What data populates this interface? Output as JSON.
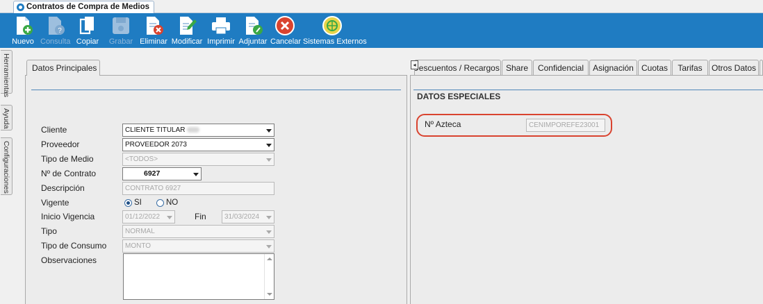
{
  "window": {
    "tab_title": "Contratos de Compra de Medios"
  },
  "toolbar": {
    "buttons": [
      {
        "label": "Nuevo",
        "icon": "new-doc-icon",
        "enabled": true
      },
      {
        "label": "Consulta",
        "icon": "query-doc-icon",
        "enabled": false
      },
      {
        "label": "Copiar",
        "icon": "copy-icon",
        "enabled": true
      },
      {
        "label": "Grabar",
        "icon": "save-disk-icon",
        "enabled": false
      },
      {
        "label": "Eliminar",
        "icon": "delete-doc-icon",
        "enabled": true
      },
      {
        "label": "Modificar",
        "icon": "edit-doc-icon",
        "enabled": true
      },
      {
        "label": "Imprimir",
        "icon": "printer-icon",
        "enabled": true
      },
      {
        "label": "Adjuntar",
        "icon": "attach-doc-icon",
        "enabled": true
      },
      {
        "label": "Cancelar",
        "icon": "cancel-icon",
        "enabled": true
      },
      {
        "label": "Sistemas Externos",
        "icon": "external-systems-icon",
        "enabled": true
      }
    ]
  },
  "side_tabs": [
    "Herramientas",
    "Ayuda",
    "Configuraciones"
  ],
  "left": {
    "tab": "Datos Principales",
    "form": {
      "cliente": {
        "label": "Cliente",
        "value": "CLIENTE TITULAR"
      },
      "proveedor": {
        "label": "Proveedor",
        "value": "PROVEEDOR 2073"
      },
      "tipo_medio": {
        "label": "Tipo de Medio",
        "value": "<TODOS>"
      },
      "contrato": {
        "label": "Nº de Contrato",
        "value": "6927"
      },
      "descripcion": {
        "label": "Descripción",
        "value": "CONTRATO 6927"
      },
      "vigente": {
        "label": "Vigente",
        "opt_si": "SI",
        "opt_no": "NO",
        "selected": "SI"
      },
      "inicio": {
        "label": "Inicio Vigencia",
        "value": "01/12/2022"
      },
      "fin": {
        "label": "Fin",
        "value": "31/03/2024"
      },
      "tipo": {
        "label": "Tipo",
        "value": "NORMAL"
      },
      "tipo_consumo": {
        "label": "Tipo de Consumo",
        "value": "MONTO"
      },
      "observaciones": {
        "label": "Observaciones",
        "value": ""
      }
    }
  },
  "right": {
    "tabs": [
      "Descuentos / Recargos",
      "Share",
      "Confidencial",
      "Asignación",
      "Cuotas",
      "Tarifas",
      "Otros Datos"
    ],
    "active_tab": "Otros Datos",
    "section_title": "DATOS ESPECIALES",
    "azteca": {
      "label": "Nº Azteca",
      "value": "CENIMPOREFE23001"
    }
  },
  "colors": {
    "toolbar": "#1f7cc2",
    "highlight": "#d9432f",
    "panel": "#ececec"
  }
}
